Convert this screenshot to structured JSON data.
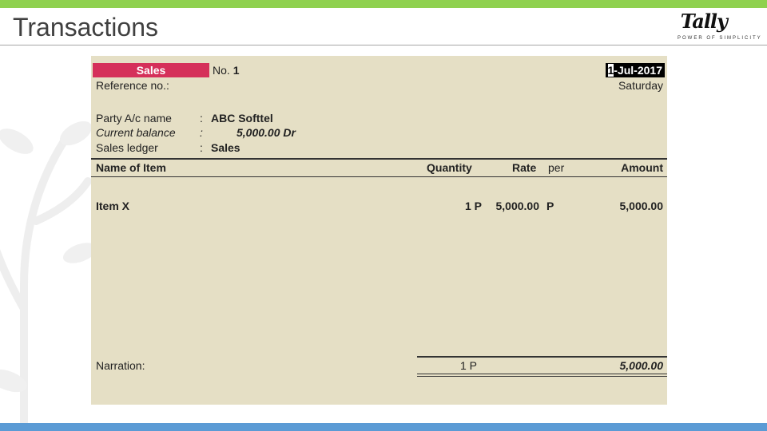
{
  "slide": {
    "title": "Transactions",
    "logo_word": "Tally",
    "logo_tagline": "POWER OF SIMPLICITY"
  },
  "voucher": {
    "type": "Sales",
    "no_label": "No.",
    "no_value": "1",
    "date_cursor": "1",
    "date_rest": "-Jul-2017",
    "weekday": "Saturday",
    "reference_label": "Reference no.:",
    "party_label": "Party A/c name",
    "party_value": "ABC Softtel",
    "balance_label": "Current balance",
    "balance_value": "5,000.00 Dr",
    "ledger_label": "Sales ledger",
    "ledger_value": "Sales",
    "colon": ":"
  },
  "table": {
    "columns": {
      "name": "Name of Item",
      "quantity": "Quantity",
      "rate": "Rate",
      "per": "per",
      "amount": "Amount"
    },
    "rows": [
      {
        "name": "Item X",
        "quantity": "1 P",
        "rate": "5,000.00",
        "per": "P",
        "amount": "5,000.00"
      }
    ]
  },
  "footer": {
    "narration_label": "Narration:",
    "total_quantity": "1 P",
    "total_amount": "5,000.00"
  },
  "colors": {
    "top_bar": "#8fd14f",
    "bottom_bar": "#5b9bd5",
    "voucher_type_bg": "#d5305a",
    "screen_bg": "#e5dfc5"
  }
}
